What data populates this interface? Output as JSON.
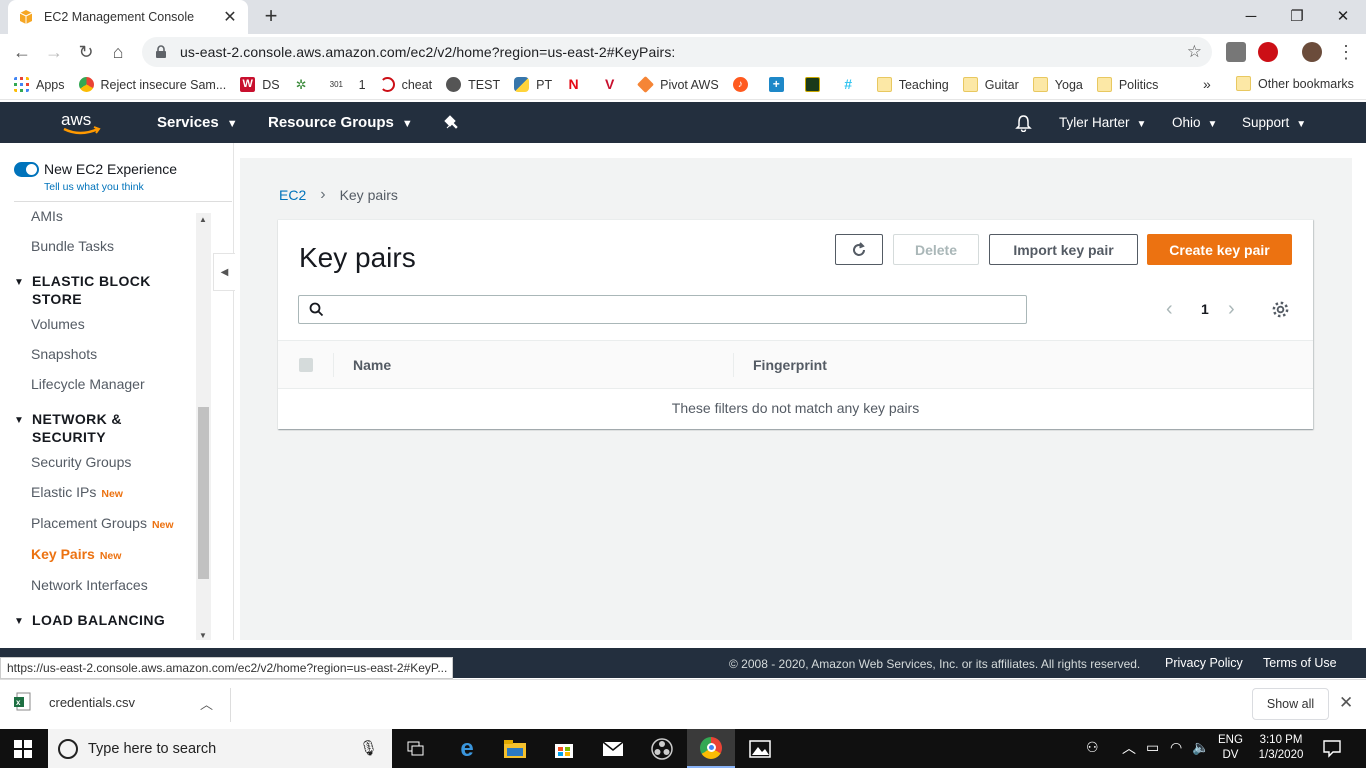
{
  "browser": {
    "tab_title": "EC2 Management Console",
    "url": "us-east-2.console.aws.amazon.com/ec2/v2/home?region=us-east-2#KeyPairs:",
    "bookmarks": [
      {
        "label": "Apps",
        "icon": "apps-grid-icon"
      },
      {
        "label": "Reject insecure Sam...",
        "icon": "chrome-icon"
      },
      {
        "label": "DS",
        "icon": "w-logo-icon"
      },
      {
        "label": "",
        "icon": "plant-icon"
      },
      {
        "label": "1",
        "icon": "301-icon"
      },
      {
        "label": "cheat",
        "icon": "opera-icon"
      },
      {
        "label": "TEST",
        "icon": "globe-icon"
      },
      {
        "label": "PT",
        "icon": "python-icon"
      },
      {
        "label": "",
        "icon": "netflix-icon"
      },
      {
        "label": "",
        "icon": "v-logo-icon"
      },
      {
        "label": "Pivot AWS",
        "icon": "box-icon"
      },
      {
        "label": "",
        "icon": "music-icon"
      },
      {
        "label": "",
        "icon": "medical-icon"
      },
      {
        "label": "",
        "icon": "badge-icon"
      },
      {
        "label": "",
        "icon": "slack-icon"
      },
      {
        "label": "Teaching",
        "icon": "folder-icon"
      },
      {
        "label": "Guitar",
        "icon": "folder-icon"
      },
      {
        "label": "Yoga",
        "icon": "folder-icon"
      },
      {
        "label": "Politics",
        "icon": "folder-icon"
      }
    ],
    "more_bookmarks": "»",
    "other_bookmarks": "Other bookmarks"
  },
  "aws_header": {
    "logo_text": "aws",
    "services": "Services",
    "resource_groups": "Resource Groups",
    "user": "Tyler Harter",
    "region": "Ohio",
    "support": "Support"
  },
  "sidebar": {
    "toggle_label": "New EC2 Experience",
    "toggle_sub": "Tell us what you think",
    "new_badge": "New",
    "items": [
      {
        "label": "AMIs"
      },
      {
        "label": "Bundle Tasks"
      },
      {
        "label": "Volumes"
      },
      {
        "label": "Snapshots"
      },
      {
        "label": "Lifecycle Manager"
      },
      {
        "label": "Security Groups"
      },
      {
        "label": "Elastic IPs"
      },
      {
        "label": "Placement Groups"
      },
      {
        "label": "Key Pairs"
      },
      {
        "label": "Network Interfaces"
      }
    ],
    "sections": [
      {
        "label": "ELASTIC BLOCK STORE"
      },
      {
        "label": "NETWORK & SECURITY"
      },
      {
        "label": "LOAD BALANCING"
      }
    ]
  },
  "main": {
    "breadcrumb_root": "EC2",
    "breadcrumb_current": "Key pairs",
    "title": "Key pairs",
    "delete_label": "Delete",
    "import_label": "Import key pair",
    "create_label": "Create key pair",
    "search_placeholder": "",
    "page_number": "1",
    "columns": [
      "Name",
      "Fingerprint"
    ],
    "empty_message": "These filters do not match any key pairs"
  },
  "footer": {
    "status_url": "https://us-east-2.console.aws.amazon.com/ec2/v2/home?region=us-east-2#KeyP...",
    "copyright": "© 2008 - 2020, Amazon Web Services, Inc. or its affiliates. All rights reserved.",
    "privacy": "Privacy Policy",
    "terms": "Terms of Use"
  },
  "downloads": {
    "file_name": "credentials.csv",
    "show_all": "Show all"
  },
  "taskbar": {
    "search_placeholder": "Type here to search",
    "lang_line1": "ENG",
    "lang_line2": "DV",
    "time": "3:10 PM",
    "date": "1/3/2020"
  },
  "colors": {
    "aws_nav": "#232f3e",
    "aws_orange": "#ec7211",
    "link_blue": "#0073bb"
  }
}
